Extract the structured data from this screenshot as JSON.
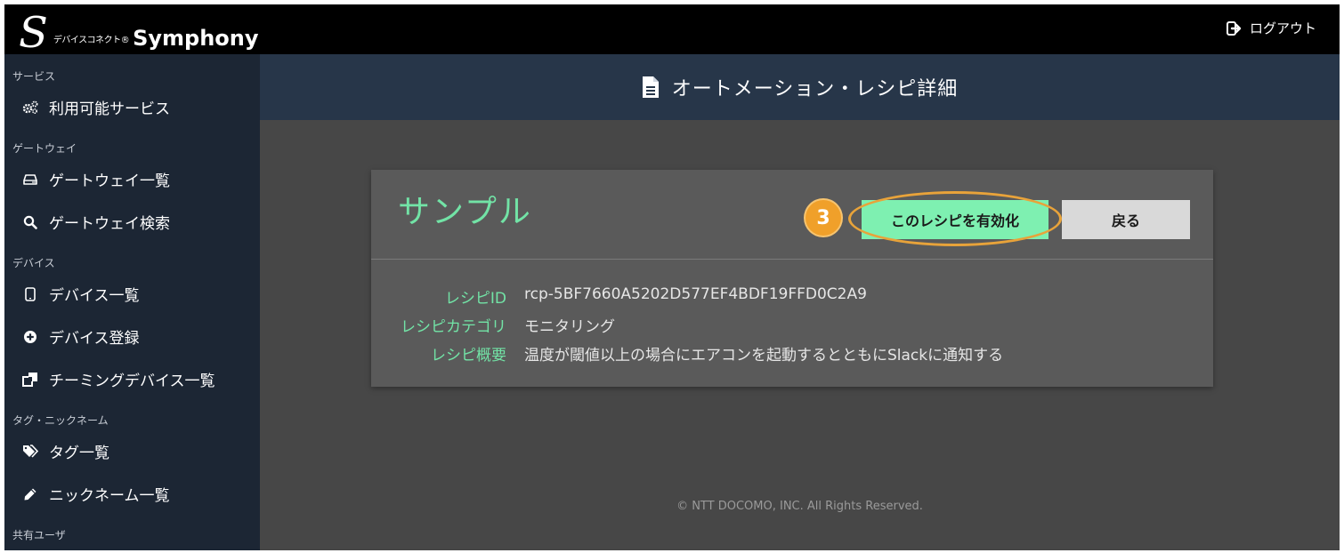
{
  "app": {
    "logo_mark": "S",
    "logo_sub": "デバイスコネクト®",
    "logo_name": "Symphony",
    "logout_label": "ログアウト"
  },
  "sidebar": {
    "sections": [
      {
        "label": "サービス",
        "items": [
          {
            "label": "利用可能サービス",
            "icon": "gears-icon"
          }
        ]
      },
      {
        "label": "ゲートウェイ",
        "items": [
          {
            "label": "ゲートウェイ一覧",
            "icon": "hdd-icon"
          },
          {
            "label": "ゲートウェイ検索",
            "icon": "search-icon"
          }
        ]
      },
      {
        "label": "デバイス",
        "items": [
          {
            "label": "デバイス一覧",
            "icon": "tablet-icon"
          },
          {
            "label": "デバイス登録",
            "icon": "plus-circle-icon"
          },
          {
            "label": "チーミングデバイス一覧",
            "icon": "clone-icon"
          }
        ]
      },
      {
        "label": "タグ・ニックネーム",
        "items": [
          {
            "label": "タグ一覧",
            "icon": "tags-icon"
          },
          {
            "label": "ニックネーム一覧",
            "icon": "pencil-icon"
          }
        ]
      },
      {
        "label": "共有ユーザ",
        "items": []
      }
    ]
  },
  "header": {
    "title": "オートメーション・レシピ詳細",
    "icon": "file-text-icon"
  },
  "recipe": {
    "title": "サンプル",
    "step_badge": "3",
    "enable_label": "このレシピを有効化",
    "back_label": "戻る",
    "details": [
      {
        "key": "レシピID",
        "value": "rcp-5BF7660A5202D577EF4BDF19FFD0C2A9"
      },
      {
        "key": "レシピカテゴリ",
        "value": "モニタリング"
      },
      {
        "key": "レシピ概要",
        "value": "温度が閾値以上の場合にエアコンを起動するとともにSlackに通知する"
      }
    ]
  },
  "footer": {
    "copyright": "© NTT DOCOMO, INC. All Rights Reserved."
  },
  "colors": {
    "accent": "#72e3a6",
    "button_green": "#7ef0b1",
    "highlight": "#e8a33a",
    "sidebar": "#1c2634",
    "header": "#273649"
  }
}
